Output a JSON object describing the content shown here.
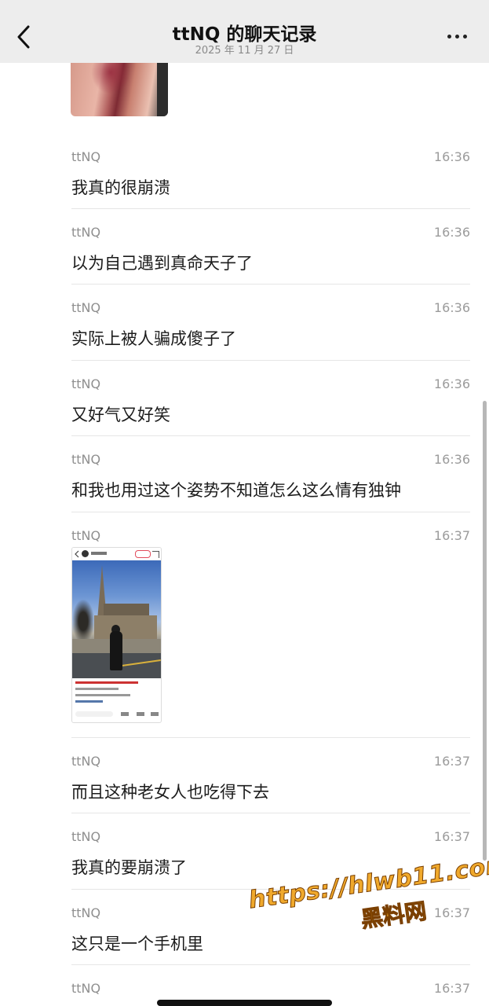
{
  "header": {
    "title": "ttNQ 的聊天记录",
    "subtitle": "2025 年 11 月 27 日"
  },
  "messages": [
    {
      "sender": "ttNQ",
      "time": "16:36",
      "text": "我真的很崩溃"
    },
    {
      "sender": "ttNQ",
      "time": "16:36",
      "text": "以为自己遇到真命天子了"
    },
    {
      "sender": "ttNQ",
      "time": "16:36",
      "text": "实际上被人骗成傻子了"
    },
    {
      "sender": "ttNQ",
      "time": "16:36",
      "text": "又好气又好笑"
    },
    {
      "sender": "ttNQ",
      "time": "16:36",
      "text": "和我也用过这个姿势不知道怎么这么情有独钟"
    },
    {
      "sender": "ttNQ",
      "time": "16:37",
      "text": "",
      "attachment": "screenshot-image"
    },
    {
      "sender": "ttNQ",
      "time": "16:37",
      "text": "而且这种老女人也吃得下去"
    },
    {
      "sender": "ttNQ",
      "time": "16:37",
      "text": "我真的要崩溃了"
    },
    {
      "sender": "ttNQ",
      "time": "16:37",
      "text": "这只是一个手机里"
    },
    {
      "sender": "ttNQ",
      "time": "16:37",
      "text": ""
    }
  ],
  "watermark": {
    "url": "https://hlwb11.com",
    "name": "黑料网"
  },
  "icons": {
    "back": "chevron-left-icon",
    "more": "more-dots-icon"
  }
}
